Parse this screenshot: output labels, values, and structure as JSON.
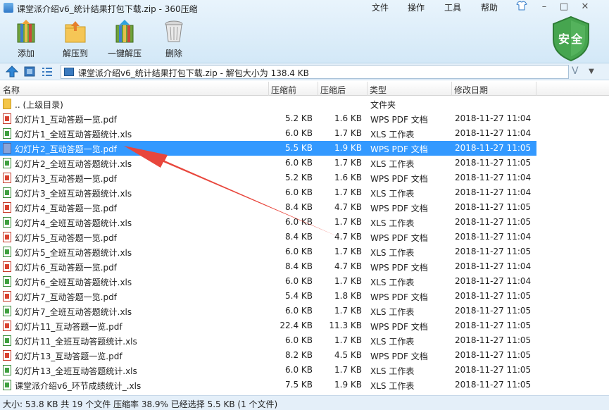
{
  "window": {
    "title": "课堂派介绍v6_统计结果打包下载.zip - 360压缩",
    "menu": [
      "文件",
      "操作",
      "工具",
      "帮助"
    ],
    "controls": [
      "minimize",
      "maximize",
      "close"
    ]
  },
  "toolbar": {
    "buttons": [
      {
        "label": "添加",
        "icon": "add-archive-icon"
      },
      {
        "label": "解压到",
        "icon": "extract-to-icon"
      },
      {
        "label": "一键解压",
        "icon": "one-click-extract-icon"
      },
      {
        "label": "删除",
        "icon": "trash-icon"
      }
    ],
    "security_badge": "安全"
  },
  "address": {
    "path": "课堂派介绍v6_统计结果打包下载.zip - 解包大小为 138.4 KB"
  },
  "columns": [
    "名称",
    "压缩前",
    "压缩后",
    "类型",
    "修改日期"
  ],
  "parent_row": {
    "name": ".. (上级目录)",
    "type": "文件夹"
  },
  "rows": [
    {
      "name": "幻灯片1_互动答题一览.pdf",
      "size": "5.2 KB",
      "packed": "1.6 KB",
      "type": "WPS PDF 文档",
      "date": "2018-11-27 11:04",
      "kind": "pdf"
    },
    {
      "name": "幻灯片1_全班互动答题统计.xls",
      "size": "6.0 KB",
      "packed": "1.7 KB",
      "type": "XLS 工作表",
      "date": "2018-11-27 11:04",
      "kind": "xls"
    },
    {
      "name": "幻灯片2_互动答题一览.pdf",
      "size": "5.5 KB",
      "packed": "1.9 KB",
      "type": "WPS PDF 文档",
      "date": "2018-11-27 11:05",
      "kind": "sel",
      "selected": true
    },
    {
      "name": "幻灯片2_全班互动答题统计.xls",
      "size": "6.0 KB",
      "packed": "1.7 KB",
      "type": "XLS 工作表",
      "date": "2018-11-27 11:05",
      "kind": "xls"
    },
    {
      "name": "幻灯片3_互动答题一览.pdf",
      "size": "5.2 KB",
      "packed": "1.6 KB",
      "type": "WPS PDF 文档",
      "date": "2018-11-27 11:04",
      "kind": "pdf"
    },
    {
      "name": "幻灯片3_全班互动答题统计.xls",
      "size": "6.0 KB",
      "packed": "1.7 KB",
      "type": "XLS 工作表",
      "date": "2018-11-27 11:04",
      "kind": "xls"
    },
    {
      "name": "幻灯片4_互动答题一览.pdf",
      "size": "8.4 KB",
      "packed": "4.7 KB",
      "type": "WPS PDF 文档",
      "date": "2018-11-27 11:05",
      "kind": "pdf"
    },
    {
      "name": "幻灯片4_全班互动答题统计.xls",
      "size": "6.0 KB",
      "packed": "1.7 KB",
      "type": "XLS 工作表",
      "date": "2018-11-27 11:05",
      "kind": "xls"
    },
    {
      "name": "幻灯片5_互动答题一览.pdf",
      "size": "8.4 KB",
      "packed": "4.7 KB",
      "type": "WPS PDF 文档",
      "date": "2018-11-27 11:04",
      "kind": "pdf"
    },
    {
      "name": "幻灯片5_全班互动答题统计.xls",
      "size": "6.0 KB",
      "packed": "1.7 KB",
      "type": "XLS 工作表",
      "date": "2018-11-27 11:05",
      "kind": "xls"
    },
    {
      "name": "幻灯片6_互动答题一览.pdf",
      "size": "8.4 KB",
      "packed": "4.7 KB",
      "type": "WPS PDF 文档",
      "date": "2018-11-27 11:04",
      "kind": "pdf"
    },
    {
      "name": "幻灯片6_全班互动答题统计.xls",
      "size": "6.0 KB",
      "packed": "1.7 KB",
      "type": "XLS 工作表",
      "date": "2018-11-27 11:04",
      "kind": "xls"
    },
    {
      "name": "幻灯片7_互动答题一览.pdf",
      "size": "5.4 KB",
      "packed": "1.8 KB",
      "type": "WPS PDF 文档",
      "date": "2018-11-27 11:05",
      "kind": "pdf"
    },
    {
      "name": "幻灯片7_全班互动答题统计.xls",
      "size": "6.0 KB",
      "packed": "1.7 KB",
      "type": "XLS 工作表",
      "date": "2018-11-27 11:05",
      "kind": "xls"
    },
    {
      "name": "幻灯片11_互动答题一览.pdf",
      "size": "22.4 KB",
      "packed": "11.3 KB",
      "type": "WPS PDF 文档",
      "date": "2018-11-27 11:05",
      "kind": "pdf"
    },
    {
      "name": "幻灯片11_全班互动答题统计.xls",
      "size": "6.0 KB",
      "packed": "1.7 KB",
      "type": "XLS 工作表",
      "date": "2018-11-27 11:05",
      "kind": "xls"
    },
    {
      "name": "幻灯片13_互动答题一览.pdf",
      "size": "8.2 KB",
      "packed": "4.5 KB",
      "type": "WPS PDF 文档",
      "date": "2018-11-27 11:05",
      "kind": "pdf"
    },
    {
      "name": "幻灯片13_全班互动答题统计.xls",
      "size": "6.0 KB",
      "packed": "1.7 KB",
      "type": "XLS 工作表",
      "date": "2018-11-27 11:05",
      "kind": "xls"
    },
    {
      "name": "课堂派介绍v6_环节成绩统计_.xls",
      "size": "7.5 KB",
      "packed": "1.9 KB",
      "type": "XLS 工作表",
      "date": "2018-11-27 11:05",
      "kind": "xls"
    }
  ],
  "status": "大小: 53.8 KB 共 19 个文件 压缩率 38.9% 已经选择 5.5 KB (1 个文件)",
  "colors": {
    "selection": "#3399ff",
    "annotation_arrow": "#e8463c",
    "badge": "#3fa349"
  }
}
